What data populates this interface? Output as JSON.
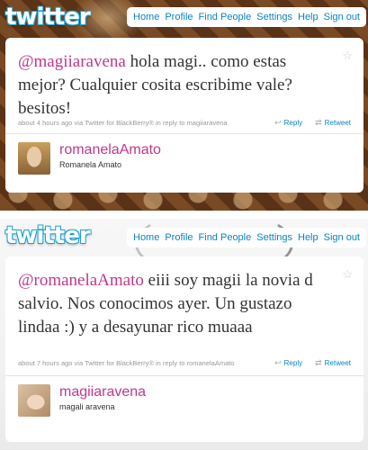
{
  "nav": [
    "Home",
    "Profile",
    "Find People",
    "Settings",
    "Help",
    "Sign out"
  ],
  "logo": "twitter",
  "tweets": [
    {
      "mention": "@magiiaravena",
      "text": " hola magi.. como estas mejor? Cualquier cosita escribime vale? besitos!",
      "meta": "about 4 hours ago via Twitter for BlackBerry® in reply to magiiaravena",
      "reply": "Reply",
      "retweet": "Retweet",
      "screen_name": "romanelaAmato",
      "full_name": "Romanela Amato"
    },
    {
      "mention": "@romanelaAmato",
      "text": " eiii soy magii la novia d salvio. Nos conocimos ayer. Un gustazo lindaa :) y a desayunar rico muaaa",
      "meta": "about 7 hours ago via Twitter for BlackBerry® in reply to romanelaAmato",
      "reply": "Reply",
      "retweet": "Retweet",
      "screen_name": "magiiaravena",
      "full_name": "magali aravena"
    }
  ],
  "icons": {
    "star": "star-icon",
    "reply": "reply-arrow-icon",
    "retweet": "retweet-icon"
  },
  "colors": {
    "link": "#0a84c0",
    "mention": "#c0398a",
    "meta": "#999999"
  }
}
